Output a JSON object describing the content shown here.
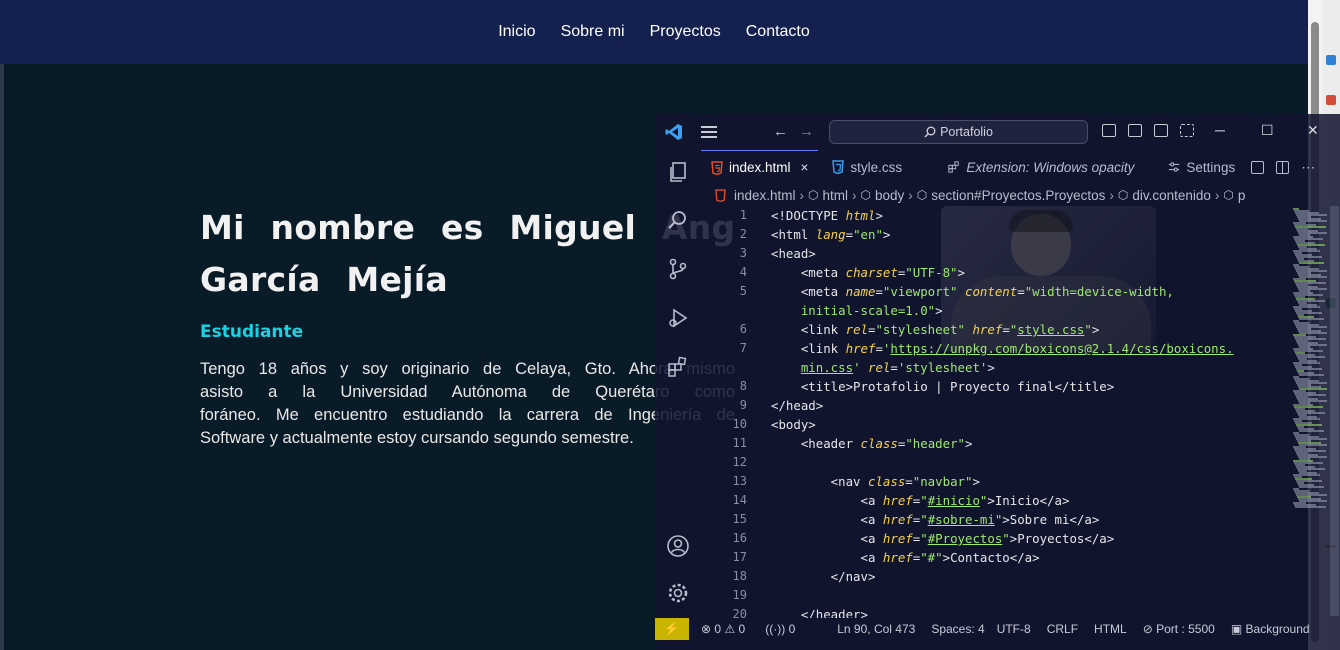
{
  "site": {
    "nav": [
      "Inicio",
      "Sobre mi",
      "Proyectos",
      "Contacto"
    ],
    "hero": {
      "title_line1": "Mi nombre es Miguel Angel",
      "title_line2": "García Mejía",
      "subtitle": "Estudiante",
      "paragraph_lines": [
        "Tengo 18 años y soy originario de Celaya, Gto. Ahora mismo",
        "asisto a la Universidad Autónoma de Querétaro como",
        "foráneo. Me encuentro estudiando la carrera de Ingeniería de",
        "Software y actualmente estoy cursando segundo semestre."
      ]
    }
  },
  "vscode": {
    "title_search": "Portafolio",
    "colors": {
      "accent": "#6b7cff",
      "remote": "#c9b400",
      "string": "#9fe870",
      "attr": "#f6d34a"
    },
    "tabs": [
      {
        "label": "index.html",
        "icon": "html5-icon",
        "active": true,
        "close": "×"
      },
      {
        "label": "style.css",
        "icon": "css3-icon",
        "active": false
      },
      {
        "label": "Extension: Windows opacity",
        "icon": "extension-icon",
        "active": false
      },
      {
        "label": "Settings",
        "icon": "settings-sliders-icon",
        "active": false
      }
    ],
    "breadcrumb": [
      "index.html",
      "html",
      "body",
      "section#Proyectos.Proyectos",
      "div.contenido",
      "p"
    ],
    "line_numbers": [
      "1",
      "2",
      "3",
      "4",
      "5",
      "",
      "6",
      "7",
      "",
      "8",
      "9",
      "10",
      "11",
      "12",
      "13",
      "14",
      "15",
      "16",
      "17",
      "18",
      "19",
      "20"
    ],
    "status": {
      "remote": "⚡",
      "errors": "0",
      "warnings": "0",
      "ports": "0",
      "position": "Ln 90, Col 473",
      "spaces": "Spaces: 4",
      "encoding": "UTF-8",
      "eol": "CRLF",
      "language": "HTML",
      "port": "Port : 5500",
      "background": "Background"
    }
  }
}
